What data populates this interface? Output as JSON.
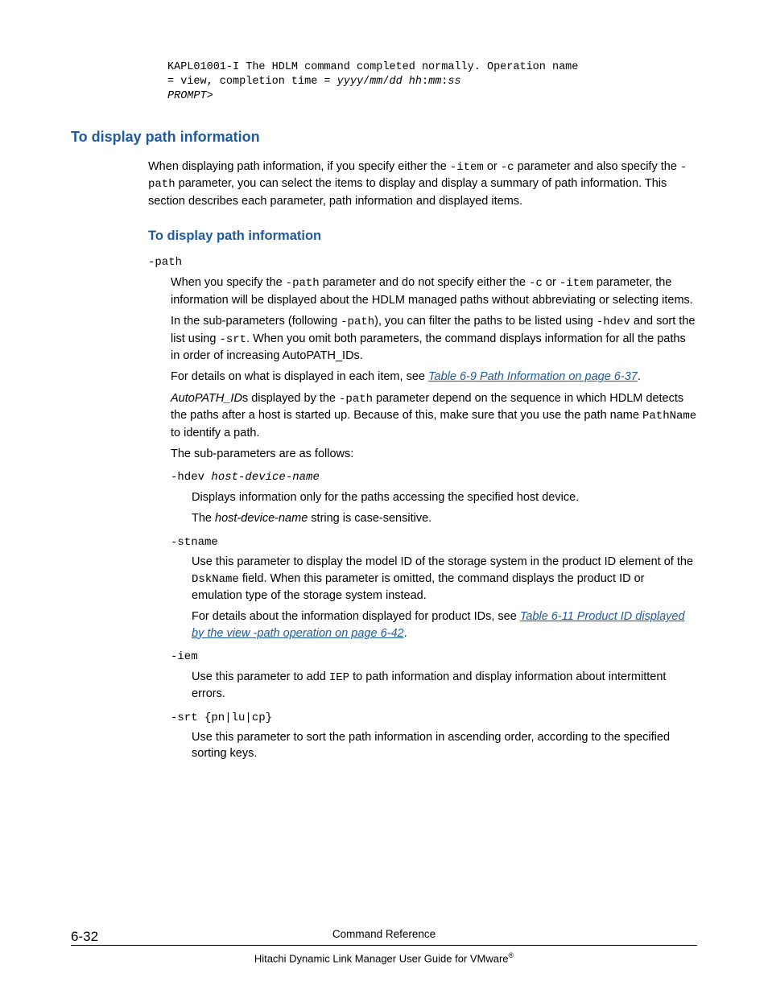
{
  "code_block": {
    "line1": "KAPL01001-I The HDLM command completed normally. Operation name ",
    "line2a": "= view, completion time = ",
    "line2b": "yyyy",
    "line2c": "/",
    "line2d": "mm",
    "line2e": "/",
    "line2f": "dd hh",
    "line2g": ":",
    "line2h": "mm",
    "line2i": ":",
    "line2j": "ss",
    "line3": "PROMPT",
    "line3b": ">"
  },
  "heading1": "To display path information",
  "intro": {
    "p1a": "When displaying path information, if you specify either the ",
    "p1_code1": "-item",
    "p1b": " or ",
    "p1_code2": "-c",
    "p1c": " parameter and also specify the ",
    "p1_code3": "-path",
    "p1d": " parameter, you can select the items to display and display a summary of path information. This section describes each parameter, path information and displayed items."
  },
  "heading2": "To display path information",
  "path_term": "-path",
  "path_body": {
    "p1a": "When you specify the ",
    "p1_code1": "-path",
    "p1b": " parameter and do not specify either the ",
    "p1_code2": "-c",
    "p1c": " or ",
    "p1_code3": "-item",
    "p1d": " parameter, the information will be displayed about the HDLM managed paths without abbreviating or selecting items.",
    "p2a": "In the sub-parameters (following ",
    "p2_code1": "-path",
    "p2b": "), you can filter the paths to be listed using ",
    "p2_code2": "-hdev",
    "p2c": " and sort the list using ",
    "p2_code3": "-srt",
    "p2d": ". When you omit both parameters, the command displays information for all the paths in order of increasing AutoPATH_IDs.",
    "p3a": "For details on what is displayed in each item, see ",
    "p3_link": "Table 6-9 Path Information on page 6-37",
    "p3b": ".",
    "p4a_italic": "AutoPATH_ID",
    "p4a2": "s displayed by the ",
    "p4_code1": "-path",
    "p4b": " parameter depend on the sequence in which HDLM detects the paths after a host is started up. Because of this, make sure that you use the path name ",
    "p4_code2": "PathName",
    "p4c": " to identify a path.",
    "p5": "The sub-parameters are as follows:"
  },
  "hdev": {
    "term_a": "-hdev ",
    "term_b": "host-device-name",
    "p1": "Displays information only for the paths accessing the specified host device.",
    "p2a": "The ",
    "p2_italic": "host-device-name",
    "p2b": " string is case-sensitive."
  },
  "stname": {
    "term": "-stname",
    "p1a": "Use this parameter to display the model ID of the storage system in the product ID element of the ",
    "p1_code": "DskName",
    "p1b": " field. When this parameter is omitted, the command displays the product ID or emulation type of the storage system instead.",
    "p2a": "For details about the information displayed for product IDs, see ",
    "p2_link": "Table 6-11 Product ID displayed by the view -path operation on page 6-42",
    "p2b": "."
  },
  "iem": {
    "term": "-iem",
    "p1a": "Use this parameter to add ",
    "p1_code": "IEP",
    "p1b": " to path information and display information about intermittent errors."
  },
  "srt": {
    "term": "-srt {pn|lu|cp}",
    "p1": "Use this parameter to sort the path information in ascending order, according to the specified sorting keys."
  },
  "footer": {
    "page_num": "6-32",
    "title": "Command Reference",
    "sub_a": "Hitachi Dynamic Link Manager User Guide for VMware",
    "sub_reg": "®"
  }
}
